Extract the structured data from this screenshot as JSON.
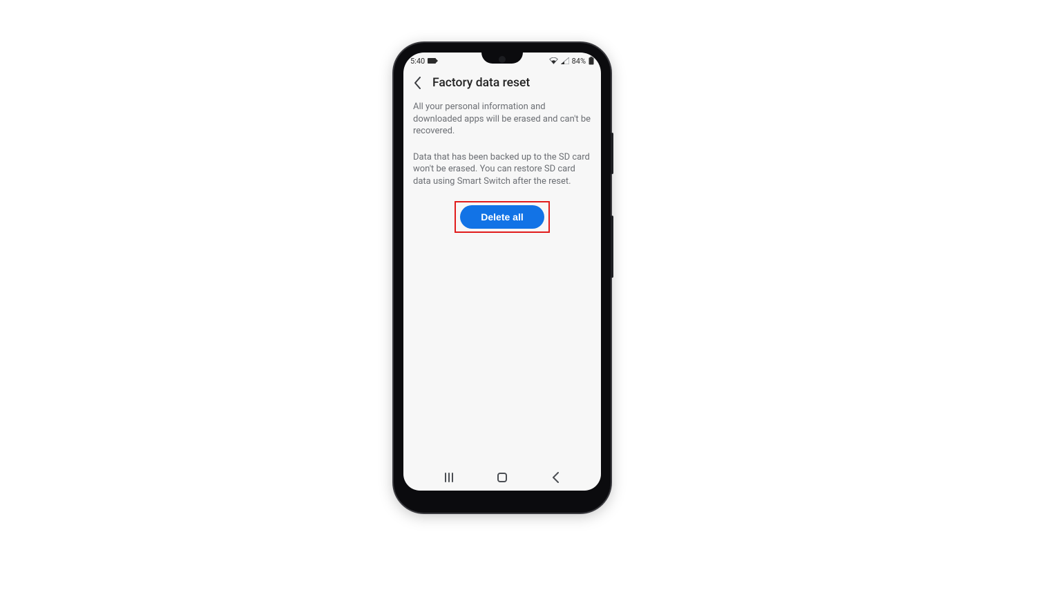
{
  "status": {
    "time": "5:40",
    "battery": "84%"
  },
  "header": {
    "title": "Factory data reset"
  },
  "body": {
    "para1": "All your personal information and downloaded apps will be erased and can't be recovered.",
    "para2": "Data that has been backed up to the SD card won't be erased. You can restore SD card data using Smart Switch after the reset."
  },
  "action": {
    "delete_label": "Delete all"
  },
  "colors": {
    "primary": "#1273e6",
    "highlight": "#e11b1b"
  }
}
